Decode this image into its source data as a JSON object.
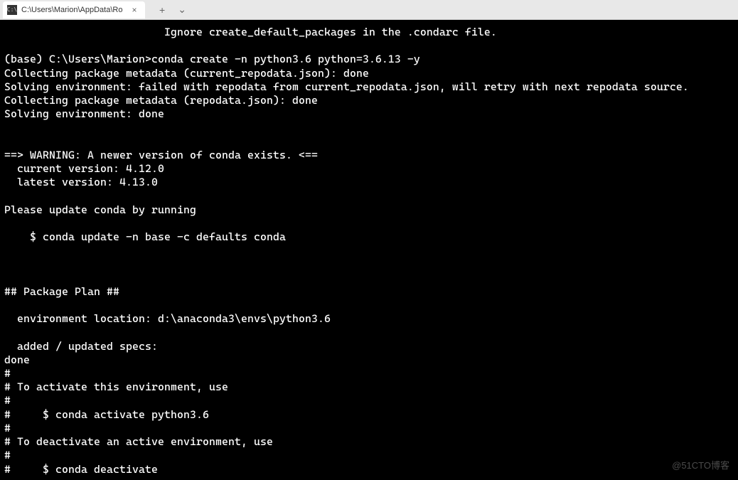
{
  "tab": {
    "icon_text": "C:\\",
    "title": "C:\\Users\\Marion\\AppData\\Ro",
    "close_glyph": "×"
  },
  "tab_controls": {
    "new_tab": "+",
    "dropdown": "⌄"
  },
  "terminal_lines": [
    "                         Ignore create_default_packages in the .condarc file.",
    "",
    "(base) C:\\Users\\Marion>conda create -n python3.6 python=3.6.13 -y",
    "Collecting package metadata (current_repodata.json): done",
    "Solving environment: failed with repodata from current_repodata.json, will retry with next repodata source.",
    "Collecting package metadata (repodata.json): done",
    "Solving environment: done",
    "",
    "",
    "==> WARNING: A newer version of conda exists. <==",
    "  current version: 4.12.0",
    "  latest version: 4.13.0",
    "",
    "Please update conda by running",
    "",
    "    $ conda update -n base -c defaults conda",
    "",
    "",
    "",
    "## Package Plan ##",
    "",
    "  environment location: d:\\anaconda3\\envs\\python3.6",
    "",
    "  added / updated specs:",
    "done",
    "#",
    "# To activate this environment, use",
    "#",
    "#     $ conda activate python3.6",
    "#",
    "# To deactivate an active environment, use",
    "#",
    "#     $ conda deactivate"
  ],
  "watermark": "@51CTO博客"
}
